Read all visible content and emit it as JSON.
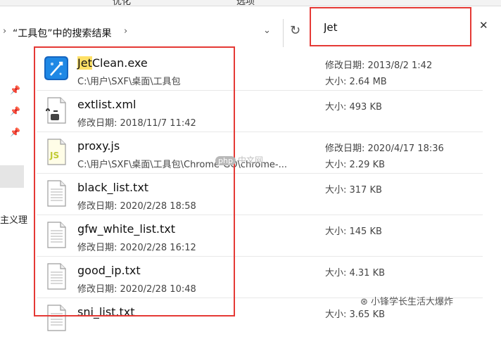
{
  "ribbon": {
    "tab_left": "优化",
    "tab_right": "选项"
  },
  "address": {
    "breadcrumb": "“工具包”中的搜索结果"
  },
  "search": {
    "value": "Jet"
  },
  "nav": {
    "text": "主义理"
  },
  "labels": {
    "modified": "修改日期:",
    "size": "大小:"
  },
  "results": [
    {
      "icon": "jetclean-app-icon",
      "name_highlight": "Jet",
      "name_rest": "Clean.exe",
      "sub": "C:\\用户\\SXF\\桌面\\工具包",
      "meta1": "修改日期: 2013/8/2 1:42",
      "meta2": "大小: 2.64 MB"
    },
    {
      "icon": "xml-file-icon",
      "name_highlight": "",
      "name_rest": "extlist.xml",
      "sub": "修改日期: 2018/11/7 11:42",
      "meta1": "大小: 493 KB",
      "meta2": ""
    },
    {
      "icon": "js-file-icon",
      "name_highlight": "",
      "name_rest": "proxy.js",
      "sub": "C:\\用户\\SXF\\桌面\\工具包\\Chrome-GO\\chrome-...",
      "meta1": "修改日期: 2020/4/17 18:36",
      "meta2": "大小: 2.29 KB"
    },
    {
      "icon": "text-file-icon",
      "name_highlight": "",
      "name_rest": "black_list.txt",
      "sub": "修改日期: 2020/2/28 18:58",
      "meta1": "大小: 317 KB",
      "meta2": ""
    },
    {
      "icon": "text-file-icon",
      "name_highlight": "",
      "name_rest": "gfw_white_list.txt",
      "sub": "修改日期: 2020/2/28 16:12",
      "meta1": "大小: 145 KB",
      "meta2": ""
    },
    {
      "icon": "text-file-icon",
      "name_highlight": "",
      "name_rest": "good_ip.txt",
      "sub": "修改日期: 2020/2/28 10:48",
      "meta1": "大小: 4.31 KB",
      "meta2": ""
    },
    {
      "icon": "text-file-icon",
      "name_highlight": "",
      "name_rest": "sni_list.txt",
      "sub": "",
      "meta1": "大小: 3.65 KB",
      "meta2": ""
    }
  ],
  "watermark": {
    "php_badge": "php",
    "php_text": "中文网",
    "wechat": "小锋学长生活大爆炸"
  },
  "colors": {
    "highlight": "#ffe066",
    "annotation_red": "#e53935"
  }
}
